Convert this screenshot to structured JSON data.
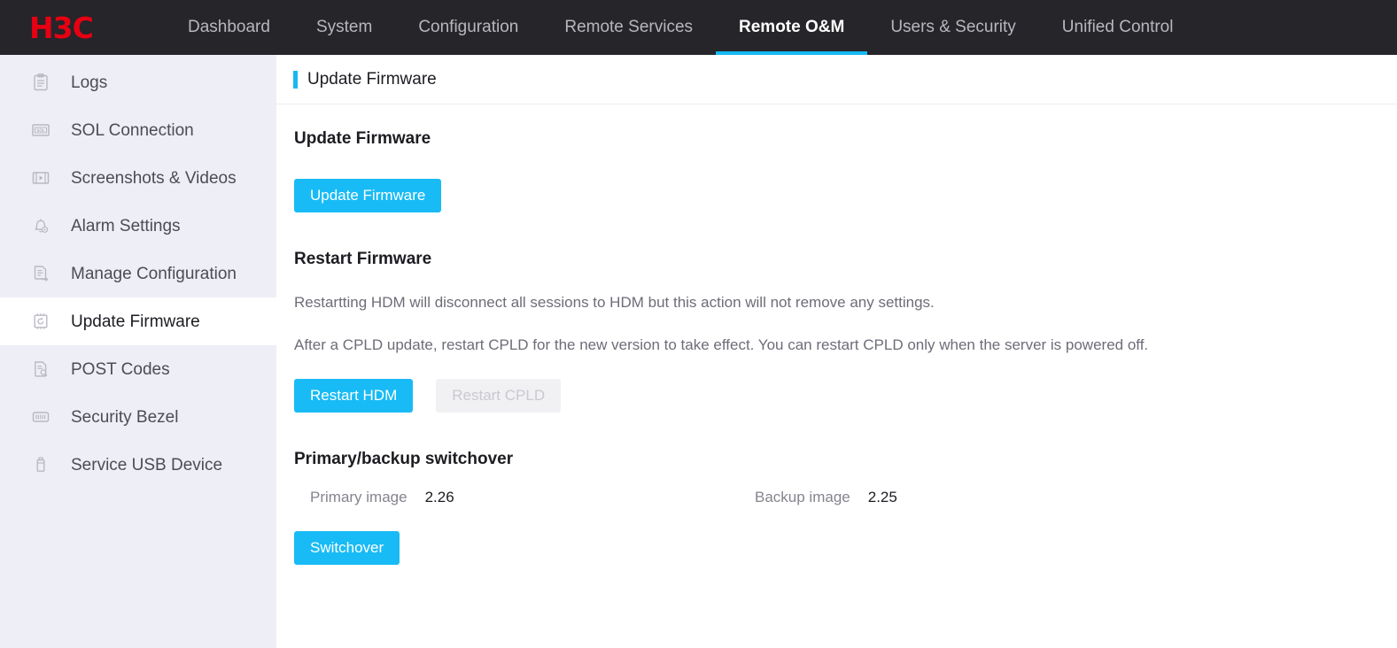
{
  "brand": {
    "logo_text": "H3C",
    "logo_color": "#e60012"
  },
  "theme": {
    "accent": "#17b9f3",
    "button": "#18bbf5",
    "topbar_bg": "#25252a",
    "sidebar_bg": "#eeeef6"
  },
  "topnav": {
    "items": [
      {
        "label": "Dashboard",
        "active": false
      },
      {
        "label": "System",
        "active": false
      },
      {
        "label": "Configuration",
        "active": false
      },
      {
        "label": "Remote Services",
        "active": false
      },
      {
        "label": "Remote O&M",
        "active": true
      },
      {
        "label": "Users & Security",
        "active": false
      },
      {
        "label": "Unified Control",
        "active": false
      }
    ]
  },
  "sidebar": {
    "items": [
      {
        "label": "Logs",
        "icon": "clipboard-icon",
        "active": false
      },
      {
        "label": "SOL Connection",
        "icon": "sol-icon",
        "active": false
      },
      {
        "label": "Screenshots & Videos",
        "icon": "video-icon",
        "active": false
      },
      {
        "label": "Alarm Settings",
        "icon": "bell-settings-icon",
        "active": false
      },
      {
        "label": "Manage Configuration",
        "icon": "document-export-icon",
        "active": false
      },
      {
        "label": "Update Firmware",
        "icon": "chip-refresh-icon",
        "active": true
      },
      {
        "label": "POST Codes",
        "icon": "document-search-icon",
        "active": false
      },
      {
        "label": "Security Bezel",
        "icon": "bezel-icon",
        "active": false
      },
      {
        "label": "Service USB Device",
        "icon": "usb-device-icon",
        "active": false
      }
    ]
  },
  "page": {
    "title": "Update Firmware"
  },
  "update_firmware": {
    "heading": "Update Firmware",
    "button_label": "Update Firmware"
  },
  "restart_firmware": {
    "heading": "Restart Firmware",
    "paragraph_1": "Restartting HDM will disconnect all sessions to HDM but this action will not remove any settings.",
    "paragraph_2": "After a CPLD update, restart CPLD for the new version to take effect. You can restart CPLD only when the server is powered off.",
    "restart_hdm_label": "Restart HDM",
    "restart_cpld_label": "Restart CPLD",
    "restart_cpld_disabled": true
  },
  "switchover": {
    "heading": "Primary/backup switchover",
    "primary_label": "Primary image",
    "primary_value": "2.26",
    "backup_label": "Backup image",
    "backup_value": "2.25",
    "button_label": "Switchover"
  }
}
